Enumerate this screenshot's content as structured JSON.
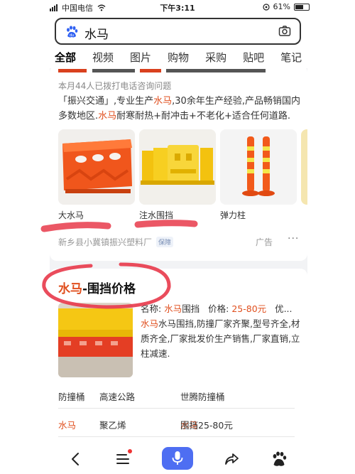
{
  "status_bar": {
    "carrier": "中国电信",
    "time": "下午3:11",
    "battery": "61%",
    "battery_level": 0.61
  },
  "search": {
    "query": "水马",
    "logo_icon": "baidu-paw-icon",
    "camera_icon": "camera-icon"
  },
  "tabs": [
    "全部",
    "视频",
    "图片",
    "购物",
    "采购",
    "贴吧",
    "笔记"
  ],
  "ad_card": {
    "consult_text": "本月44人已拨打电话咨询问题",
    "desc_parts": [
      "「振兴交通」,专业生产",
      "水马",
      ",30余年生产经验,产品畅销国内多数地区.",
      "水马",
      "耐寒耐热+耐冲击+不老化+适合任何道路."
    ],
    "gallery": [
      {
        "caption": "大水马"
      },
      {
        "caption": "注水围挡"
      },
      {
        "caption": "弹力柱"
      }
    ],
    "source": "新乡县小冀镇振兴塑料厂",
    "badge": "保障",
    "ad_label": "广告",
    "more": "···"
  },
  "result_card": {
    "title_red": "水马",
    "title_rest": "-围挡价格",
    "name_label": "名称: ",
    "name_red": "水马",
    "name_rest": "围挡",
    "price_label": "价格: ",
    "price": "25-80元",
    "extra": "优...",
    "desc_red": "水马",
    "desc_rest": "水马围挡,防撞厂家齐聚,型号齐全,材质齐全,厂家批发价生产销售,厂家直销,立柱减速.",
    "headers": [
      "防撞桶",
      "高速公路",
      "世腾防撞桶"
    ],
    "row_red": "水马",
    "row_mid": "聚乙烯",
    "row_third_red": "水马",
    "row_third_rest": "围挡25-80元"
  },
  "bottom_bar": {
    "icons": [
      "back-icon",
      "menu-icon",
      "mic-icon",
      "share-icon",
      "baidu-paw-icon"
    ]
  },
  "colors": {
    "accent_red": "#e04f1e",
    "brand_blue": "#4e6ef2",
    "annotation": "#e8394a"
  }
}
